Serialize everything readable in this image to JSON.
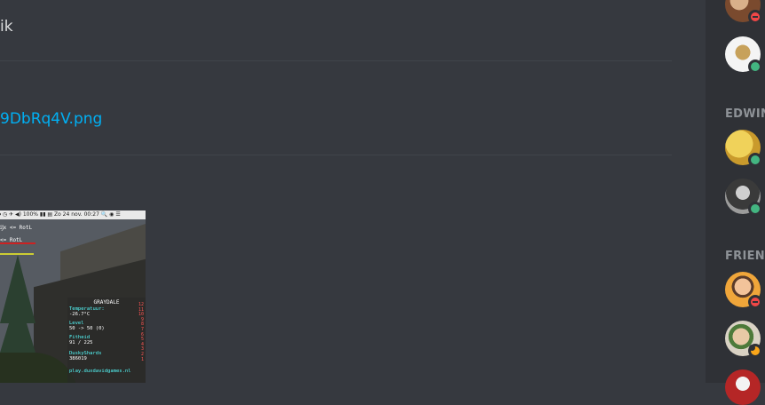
{
  "chat": {
    "message_text": "ik",
    "link_text": "9DbRq4V.png",
    "embed": {
      "statusbar": "⏺ ◷ ✈ ◀) 100% ▮▮ ▤ Zo 24 nov. 00:27 🔍 ◉ ☰",
      "chat_line_1": "ĳx <= RotL",
      "chat_line_2": "<= RotL",
      "scoreboard": {
        "title": "GRAYDALE",
        "rows": [
          {
            "label": "Temperatuur:",
            "value": "-26.7°C"
          },
          {
            "label": "Level",
            "value": "50 -> 50 (0)"
          },
          {
            "label": "Fitheid",
            "value": "91 / 225"
          },
          {
            "label": "DuskyShards",
            "value": "386019"
          },
          {
            "label": "play.duxdavidgames.nl",
            "value": ""
          }
        ],
        "numbers": [
          "12",
          "11",
          "10",
          "9",
          "8",
          "7",
          "6",
          "5",
          "4",
          "3",
          "2",
          "1"
        ]
      }
    }
  },
  "members": {
    "groups": [
      {
        "header": "EDWIN"
      },
      {
        "header": "FRIEND"
      }
    ],
    "avatars": [
      {
        "name": "member-1",
        "status": "dnd",
        "color": "#7a4a2e"
      },
      {
        "name": "member-2",
        "status": "online",
        "color": "#f4f4f4"
      },
      {
        "name": "member-3",
        "status": "online",
        "color": "#d8b44a"
      },
      {
        "name": "member-4",
        "status": "online",
        "color": "#9c9c9c"
      },
      {
        "name": "member-5",
        "status": "dnd",
        "color": "#f0a63a"
      },
      {
        "name": "member-6",
        "status": "idle",
        "color": "#d9d2c4"
      },
      {
        "name": "member-7",
        "status": "",
        "color": "#b52626"
      }
    ]
  },
  "colors": {
    "chat_bg": "#36393f",
    "sidebar_bg": "#2f3136",
    "link": "#00b0f4",
    "online": "#43b581",
    "dnd": "#f04747",
    "idle": "#faa61a"
  }
}
